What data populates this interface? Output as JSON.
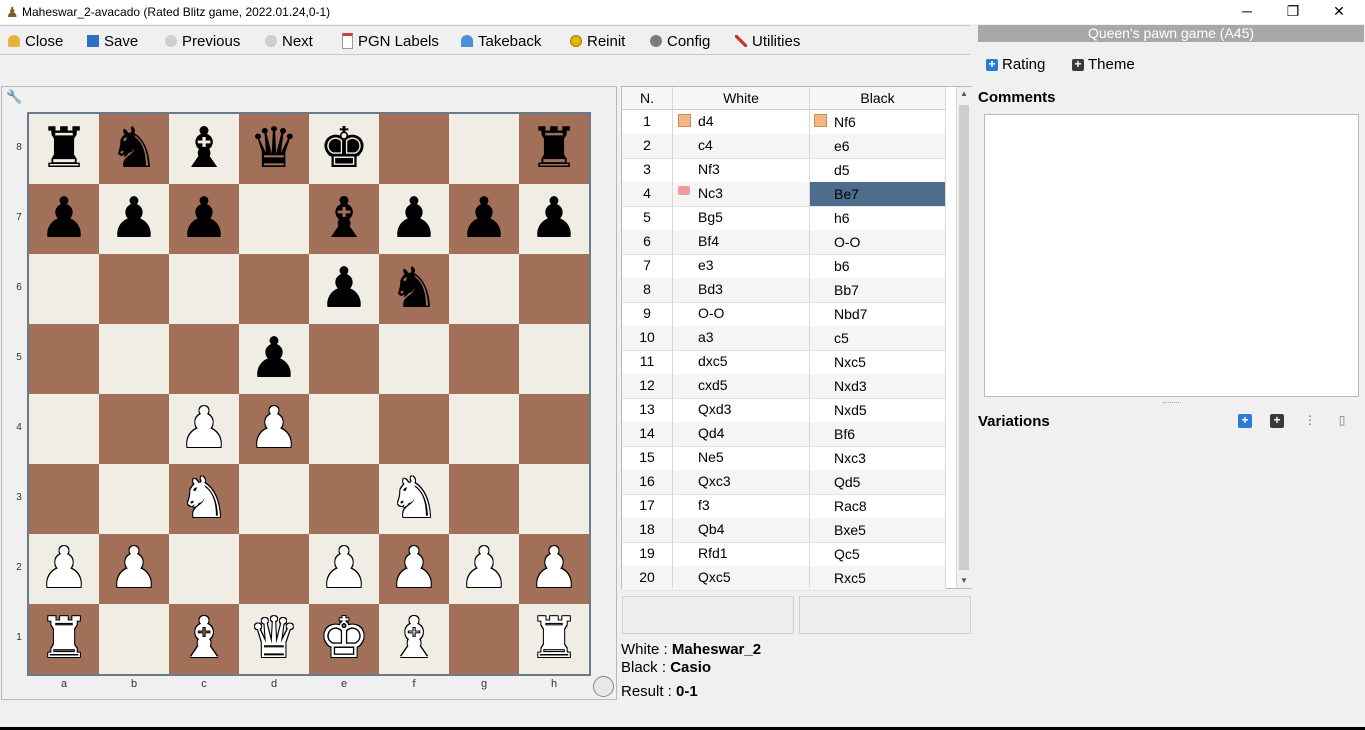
{
  "window": {
    "title": "Maheswar_2-avacado (Rated Blitz game, 2022.01.24,0-1)",
    "controls": {
      "minimize": "─",
      "restore": "❐",
      "close": "✕"
    }
  },
  "toolbar": {
    "items": [
      {
        "label": "Close",
        "icon": "person-icon",
        "color": "#e6b33c"
      },
      {
        "label": "Save",
        "icon": "floppy-icon",
        "color": "#2d6fc4"
      },
      {
        "label": "Previous",
        "icon": "previous-icon",
        "color": "#b0b0b0"
      },
      {
        "label": "Next",
        "icon": "next-icon",
        "color": "#b0b0b0"
      },
      {
        "label": "PGN Labels",
        "icon": "document-icon",
        "color": "#d04040"
      },
      {
        "label": "Takeback",
        "icon": "takeback-icon",
        "color": "#4a8fd8"
      },
      {
        "label": "Reinit",
        "icon": "reinit-icon",
        "color": "#e6b400"
      },
      {
        "label": "Config",
        "icon": "gear-icon",
        "color": "#6a6a6a"
      },
      {
        "label": "Utilities",
        "icon": "tools-icon",
        "color": "#d03030"
      }
    ]
  },
  "board": {
    "ranks": [
      "8",
      "7",
      "6",
      "5",
      "4",
      "3",
      "2",
      "1"
    ],
    "files": [
      "a",
      "b",
      "c",
      "d",
      "e",
      "f",
      "g",
      "h"
    ],
    "position": [
      [
        "br",
        "bn",
        "bb",
        "bq",
        "bk",
        "",
        "",
        "br"
      ],
      [
        "bp",
        "bp",
        "bp",
        "",
        "bb",
        "bp",
        "bp",
        "bp"
      ],
      [
        "",
        "",
        "",
        "",
        "bp",
        "bn",
        "",
        ""
      ],
      [
        "",
        "",
        "",
        "bp",
        "",
        "",
        "",
        ""
      ],
      [
        "",
        "",
        "wp",
        "wp",
        "",
        "",
        "",
        ""
      ],
      [
        "",
        "",
        "wn",
        "",
        "",
        "wn",
        "",
        ""
      ],
      [
        "wp",
        "wp",
        "",
        "",
        "wp",
        "wp",
        "wp",
        "wp"
      ],
      [
        "wr",
        "",
        "wb",
        "wq",
        "wk",
        "wb",
        "",
        "wr"
      ]
    ],
    "light_color": "#f0ede5",
    "dark_color": "#a26f58"
  },
  "moves": {
    "headers": {
      "num": "N.",
      "white": "White",
      "black": "Black"
    },
    "selected": {
      "row": 4,
      "side": "black"
    },
    "rows": [
      {
        "n": "1",
        "w": "d4",
        "b": "Nf6"
      },
      {
        "n": "2",
        "w": "c4",
        "b": "e6"
      },
      {
        "n": "3",
        "w": "Nf3",
        "b": "d5"
      },
      {
        "n": "4",
        "w": "Nc3",
        "b": "Be7"
      },
      {
        "n": "5",
        "w": "Bg5",
        "b": "h6"
      },
      {
        "n": "6",
        "w": "Bf4",
        "b": "O-O"
      },
      {
        "n": "7",
        "w": "e3",
        "b": "b6"
      },
      {
        "n": "8",
        "w": "Bd3",
        "b": "Bb7"
      },
      {
        "n": "9",
        "w": "O-O",
        "b": "Nbd7"
      },
      {
        "n": "10",
        "w": "a3",
        "b": "c5"
      },
      {
        "n": "11",
        "w": "dxc5",
        "b": "Nxc5"
      },
      {
        "n": "12",
        "w": "cxd5",
        "b": "Nxd3"
      },
      {
        "n": "13",
        "w": "Qxd3",
        "b": "Nxd5"
      },
      {
        "n": "14",
        "w": "Qd4",
        "b": "Bf6"
      },
      {
        "n": "15",
        "w": "Ne5",
        "b": "Nxc3"
      },
      {
        "n": "16",
        "w": "Qxc3",
        "b": "Qd5"
      },
      {
        "n": "17",
        "w": "f3",
        "b": "Rac8"
      },
      {
        "n": "18",
        "w": "Qb4",
        "b": "Bxe5"
      },
      {
        "n": "19",
        "w": "Rfd1",
        "b": "Qc5"
      },
      {
        "n": "20",
        "w": "Qxc5",
        "b": "Rxc5"
      }
    ]
  },
  "game_info": {
    "white_label": "White :",
    "white_name": "Maheswar_2",
    "black_label": "Black :",
    "black_name": "Casio",
    "result_label": "Result :",
    "result": "0-1"
  },
  "right_panel": {
    "opening": "Queen's pawn game (A45)",
    "rating_button": "Rating",
    "theme_button": "Theme",
    "comments_title": "Comments",
    "variations_title": "Variations"
  }
}
